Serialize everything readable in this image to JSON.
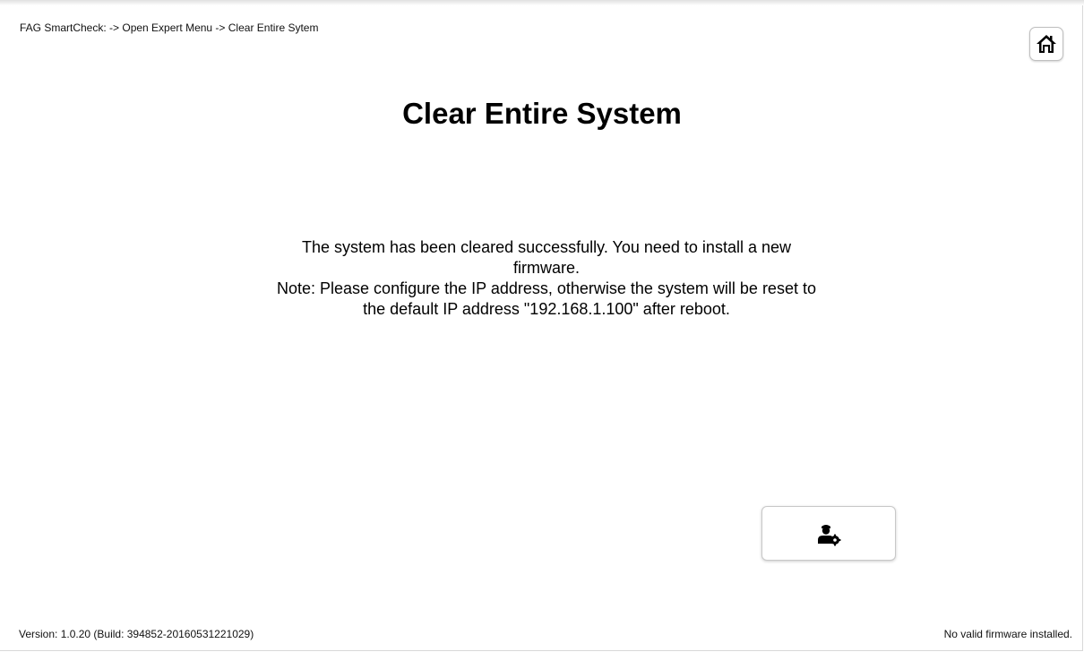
{
  "header": {
    "breadcrumb": "FAG SmartCheck: -> Open Expert Menu -> Clear Entire Sytem",
    "home_icon": "home-icon"
  },
  "main": {
    "title": "Clear Entire System",
    "message_line1": "The system has been cleared successfully. You need to install a new firmware.",
    "message_line2": "Note: Please configure the IP address, otherwise the system will be reset to the default IP address \"192.168.1.100\" after reboot."
  },
  "actions": {
    "expert_icon": "user-settings-icon"
  },
  "footer": {
    "version": "Version: 1.0.20 (Build: 394852-20160531221029)",
    "status": "No valid firmware installed."
  }
}
